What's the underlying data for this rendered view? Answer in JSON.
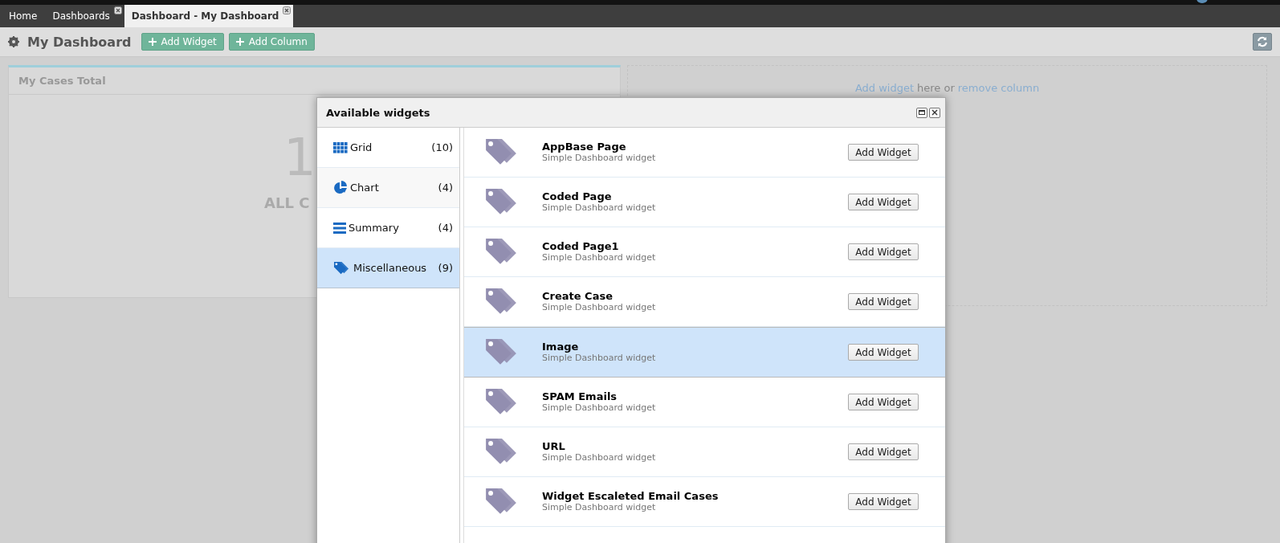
{
  "tabs": [
    {
      "label": "Home",
      "selected": false,
      "closable": false
    },
    {
      "label": "Dashboards",
      "selected": false,
      "closable": true
    },
    {
      "label": "Dashboard - My Dashboard",
      "selected": true,
      "closable": true
    }
  ],
  "toolbar": {
    "title": "My Dashboard",
    "buttons": [
      "Add Widget",
      "Add Column"
    ]
  },
  "widget": {
    "title": "My Cases Total",
    "value": "1",
    "caption": "ALL C"
  },
  "empty_column": {
    "add_link": "Add widget",
    "middle": "here or",
    "remove_link": "remove column"
  },
  "dialog": {
    "title": "Available widgets",
    "categories": [
      {
        "kind": "grid",
        "label": "Grid",
        "count": "(10)",
        "selected": false
      },
      {
        "kind": "chart",
        "label": "Chart",
        "count": "(4)",
        "selected": false
      },
      {
        "kind": "summary",
        "label": "Summary",
        "count": "(4)",
        "selected": false
      },
      {
        "kind": "misc",
        "label": "Miscellaneous",
        "count": "(9)",
        "selected": true
      }
    ],
    "widgets": [
      {
        "name": "AppBase Page",
        "description": "Simple Dashboard widget",
        "button": "Add Widget",
        "selected": false
      },
      {
        "name": "Coded Page",
        "description": "Simple Dashboard widget",
        "button": "Add Widget",
        "selected": false
      },
      {
        "name": "Coded Page1",
        "description": "Simple Dashboard widget",
        "button": "Add Widget",
        "selected": false
      },
      {
        "name": "Create Case",
        "description": "Simple Dashboard widget",
        "button": "Add Widget",
        "selected": false
      },
      {
        "name": "Image",
        "description": "Simple Dashboard widget",
        "button": "Add Widget",
        "selected": true
      },
      {
        "name": "SPAM Emails",
        "description": "Simple Dashboard widget",
        "button": "Add Widget",
        "selected": false
      },
      {
        "name": "URL",
        "description": "Simple Dashboard widget",
        "button": "Add Widget",
        "selected": false
      },
      {
        "name": "Widget Escaleted Email Cases",
        "description": "Simple Dashboard widget",
        "button": "Add Widget",
        "selected": false
      }
    ]
  }
}
